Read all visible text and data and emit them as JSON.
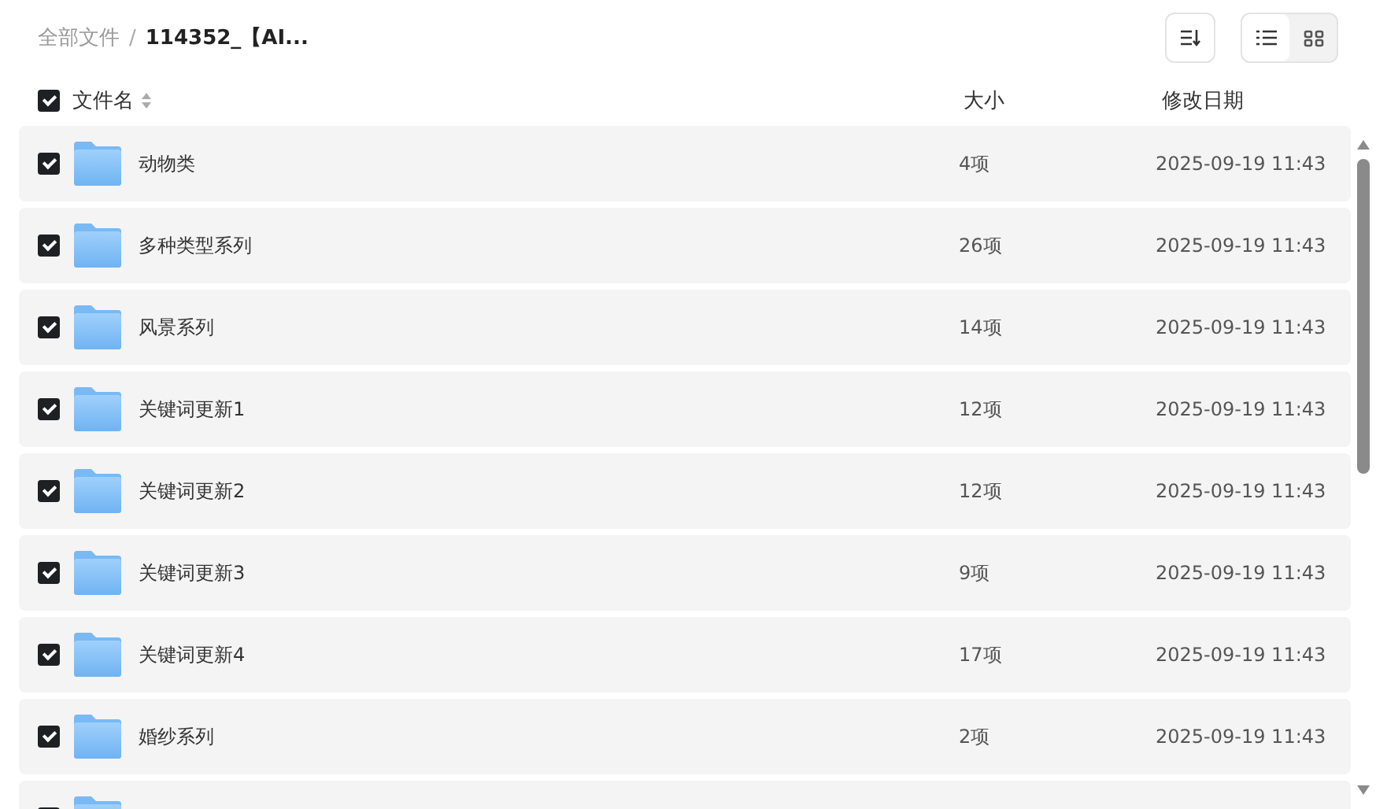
{
  "breadcrumb": [
    {
      "label": "全部文件",
      "current": false
    },
    {
      "label": "114352_【AI...",
      "current": true
    }
  ],
  "breadcrumb_separator": "/",
  "views": [
    {
      "kind": "list",
      "selected": true
    },
    {
      "kind": "grid",
      "selected": false
    }
  ],
  "columns": {
    "checked": true,
    "name": "文件名",
    "size": "大小",
    "modified": "修改日期"
  },
  "rows": [
    {
      "checked": true,
      "name": "动物类",
      "size": "4项",
      "modified": "2025-09-19 11:43"
    },
    {
      "checked": true,
      "name": "多种类型系列",
      "size": "26项",
      "modified": "2025-09-19 11:43"
    },
    {
      "checked": true,
      "name": "风景系列",
      "size": "14项",
      "modified": "2025-09-19 11:43"
    },
    {
      "checked": true,
      "name": "关键词更新1",
      "size": "12项",
      "modified": "2025-09-19 11:43"
    },
    {
      "checked": true,
      "name": "关键词更新2",
      "size": "12项",
      "modified": "2025-09-19 11:43"
    },
    {
      "checked": true,
      "name": "关键词更新3",
      "size": "9项",
      "modified": "2025-09-19 11:43"
    },
    {
      "checked": true,
      "name": "关键词更新4",
      "size": "17项",
      "modified": "2025-09-19 11:43"
    },
    {
      "checked": true,
      "name": "婚纱系列",
      "size": "2项",
      "modified": "2025-09-19 11:43"
    },
    {
      "checked": true
    }
  ]
}
